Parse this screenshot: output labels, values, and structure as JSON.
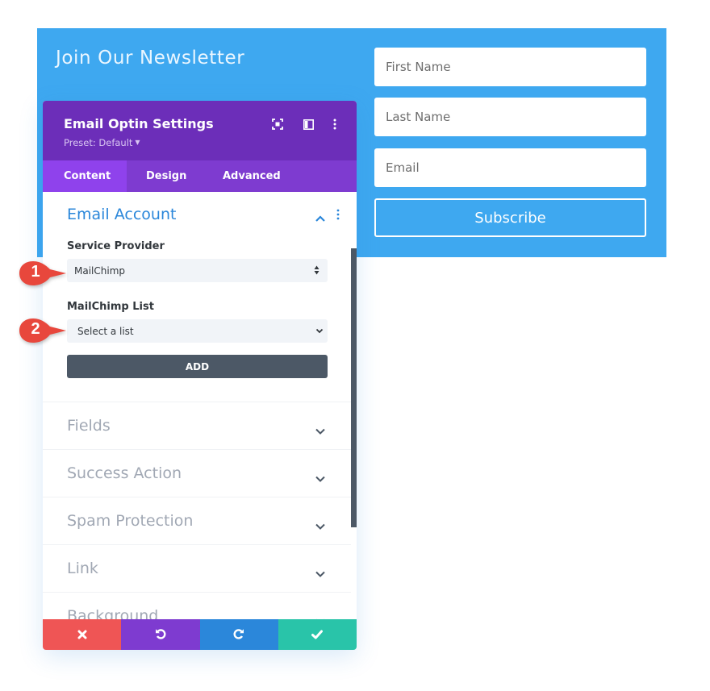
{
  "newsletter": {
    "title": "Join Our Newsletter",
    "background_color": "#3ea8f0",
    "fields": {
      "first_name_placeholder": "First Name",
      "last_name_placeholder": "Last Name",
      "email_placeholder": "Email"
    },
    "subscribe_label": "Subscribe"
  },
  "modal": {
    "title": "Email Optin Settings",
    "preset_label": "Preset: Default",
    "header_icons": [
      "expand-icon",
      "columns-icon",
      "more-vertical-icon"
    ],
    "tabs": [
      {
        "label": "Content",
        "active": true
      },
      {
        "label": "Design",
        "active": false
      },
      {
        "label": "Advanced",
        "active": false
      }
    ],
    "open_section": {
      "title": "Email Account",
      "service_provider_label": "Service Provider",
      "service_provider_value": "MailChimp",
      "list_label": "MailChimp List",
      "list_value": "Select a list",
      "add_label": "ADD"
    },
    "collapsed_sections": [
      {
        "title": "Fields"
      },
      {
        "title": "Success Action"
      },
      {
        "title": "Spam Protection"
      },
      {
        "title": "Link"
      },
      {
        "title": "Background"
      }
    ],
    "footer": {
      "buttons": [
        {
          "name": "discard",
          "icon": "close-icon",
          "color": "#ef5555"
        },
        {
          "name": "undo",
          "icon": "undo-icon",
          "color": "#7e3bd0"
        },
        {
          "name": "redo",
          "icon": "redo-icon",
          "color": "#2b87da"
        },
        {
          "name": "save",
          "icon": "check-icon",
          "color": "#29c4a9"
        }
      ]
    },
    "colors": {
      "header": "#6c2eb9",
      "tabs": "#7e3bd0",
      "active_tab": "#8f42ec",
      "accent": "#2b87da"
    }
  },
  "callouts": [
    {
      "number": "1"
    },
    {
      "number": "2"
    }
  ]
}
